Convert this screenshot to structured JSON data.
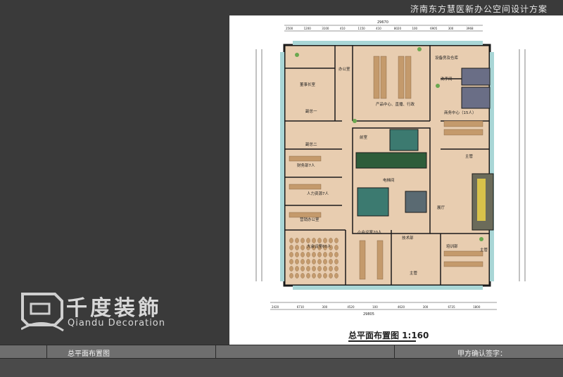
{
  "header": {
    "project_title": "济南东方慧医新办公空间设计方案"
  },
  "logo": {
    "cn": "千度装飾",
    "en": "Qiandu Decoration"
  },
  "plan": {
    "caption": "总平面布置图 1:160",
    "rooms": [
      "办公室",
      "董事长室",
      "产品中心、直播、行政",
      "设备房及仓库",
      "洗手间",
      "副总一",
      "副总二",
      "商务中心（15人）",
      "财务部7人",
      "前室",
      "主管",
      "人力资源7人",
      "电梯间",
      "展厅",
      "营销办公室",
      "大会议室60人",
      "小会议室20人",
      "技术部",
      "培训部",
      "主管",
      "主管"
    ],
    "top_dims": [
      "2500",
      "1200",
      "3100",
      "410",
      "1150",
      "410",
      "8020",
      "100",
      "6905",
      "300",
      "3968"
    ],
    "top_total": "29670",
    "bottom_dims": [
      "2420",
      "6710",
      "300",
      "4520",
      "100",
      "4620",
      "300",
      "6735",
      "1800"
    ],
    "bottom_total": "29805"
  },
  "footer": {
    "drawing_name": "总平面布置图",
    "signature_label": "甲方确认签字："
  },
  "colors": {
    "background": "#3a3a3a",
    "sheet": "#ffffff",
    "floor": "#e8cdb0",
    "wall": "#1a1a1a"
  }
}
